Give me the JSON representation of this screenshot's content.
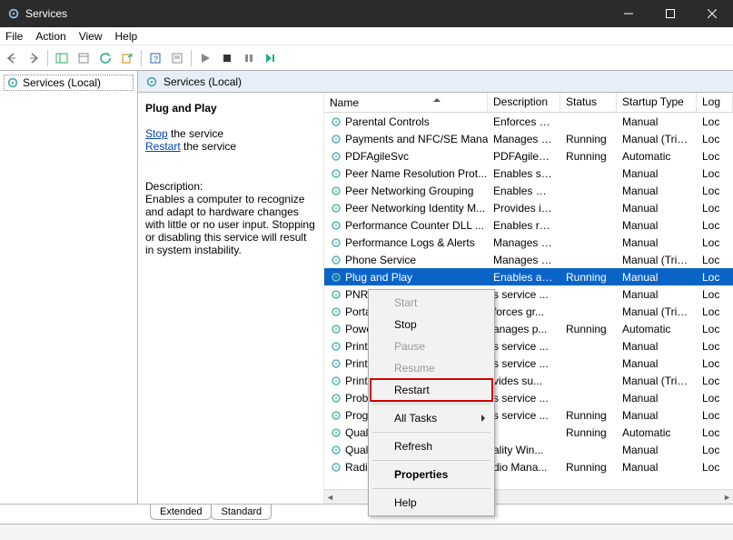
{
  "window": {
    "title": "Services"
  },
  "menubar": [
    "File",
    "Action",
    "View",
    "Help"
  ],
  "tree": {
    "root_label": "Services (Local)"
  },
  "main_header": "Services (Local)",
  "detail": {
    "selected_name": "Plug and Play",
    "stop_link": "Stop",
    "stop_suffix": " the service",
    "restart_link": "Restart",
    "restart_suffix": " the service",
    "desc_label": "Description:",
    "description": "Enables a computer to recognize and adapt to hardware changes with little or no user input. Stopping or disabling this service will result in system instability."
  },
  "columns": {
    "name": "Name",
    "desc": "Description",
    "status": "Status",
    "startup": "Startup Type",
    "logon": "Log"
  },
  "services": [
    {
      "name": "Parental Controls",
      "desc": "Enforces pa...",
      "status": "",
      "startup": "Manual",
      "logon": "Loc"
    },
    {
      "name": "Payments and NFC/SE Mana...",
      "desc": "Manages pa...",
      "status": "Running",
      "startup": "Manual (Trig...",
      "logon": "Loc"
    },
    {
      "name": "PDFAgileSvc",
      "desc": "PDFAgileSvc",
      "status": "Running",
      "startup": "Automatic",
      "logon": "Loc"
    },
    {
      "name": "Peer Name Resolution Prot...",
      "desc": "Enables serv...",
      "status": "",
      "startup": "Manual",
      "logon": "Loc"
    },
    {
      "name": "Peer Networking Grouping",
      "desc": "Enables mul...",
      "status": "",
      "startup": "Manual",
      "logon": "Loc"
    },
    {
      "name": "Peer Networking Identity M...",
      "desc": "Provides ide...",
      "status": "",
      "startup": "Manual",
      "logon": "Loc"
    },
    {
      "name": "Performance Counter DLL ...",
      "desc": "Enables rem...",
      "status": "",
      "startup": "Manual",
      "logon": "Loc"
    },
    {
      "name": "Performance Logs & Alerts",
      "desc": "Manages th...",
      "status": "",
      "startup": "Manual",
      "logon": "Loc"
    },
    {
      "name": "Phone Service",
      "desc": "Manages th...",
      "status": "",
      "startup": "Manual (Trig...",
      "logon": "Loc"
    },
    {
      "name": "Plug and Play",
      "desc": "Enables a c...",
      "status": "Running",
      "startup": "Manual",
      "logon": "Loc",
      "selected": true
    },
    {
      "name": "PNRP",
      "desc": "s service ...",
      "status": "",
      "startup": "Manual",
      "logon": "Loc"
    },
    {
      "name": "Portab",
      "desc": "forces gr...",
      "status": "",
      "startup": "Manual (Trig...",
      "logon": "Loc"
    },
    {
      "name": "Power",
      "desc": "anages p...",
      "status": "Running",
      "startup": "Automatic",
      "logon": "Loc"
    },
    {
      "name": "Print S",
      "desc": "s service ...",
      "status": "",
      "startup": "Manual",
      "logon": "Loc"
    },
    {
      "name": "Printer",
      "desc": "s service ...",
      "status": "",
      "startup": "Manual",
      "logon": "Loc"
    },
    {
      "name": "PrintW",
      "desc": "vides su...",
      "status": "",
      "startup": "Manual (Trig...",
      "logon": "Loc"
    },
    {
      "name": "Proble",
      "desc": "s service ...",
      "status": "",
      "startup": "Manual",
      "logon": "Loc"
    },
    {
      "name": "Progra",
      "desc": "s service ...",
      "status": "Running",
      "startup": "Manual",
      "logon": "Loc"
    },
    {
      "name": "Qualco",
      "desc": "",
      "status": "Running",
      "startup": "Automatic",
      "logon": "Loc"
    },
    {
      "name": "Qualit",
      "desc": "ality Win...",
      "status": "",
      "startup": "Manual",
      "logon": "Loc"
    },
    {
      "name": "Radio ",
      "desc": "dio Mana...",
      "status": "Running",
      "startup": "Manual",
      "logon": "Loc"
    }
  ],
  "context_menu": [
    {
      "label": "Start",
      "disabled": true
    },
    {
      "label": "Stop"
    },
    {
      "label": "Pause",
      "disabled": true
    },
    {
      "label": "Resume",
      "disabled": true
    },
    {
      "label": "Restart",
      "highlighted": true
    },
    {
      "sep": true
    },
    {
      "label": "All Tasks",
      "submenu": true
    },
    {
      "sep": true
    },
    {
      "label": "Refresh"
    },
    {
      "sep": true
    },
    {
      "label": "Properties",
      "bold": true
    },
    {
      "sep": true
    },
    {
      "label": "Help"
    }
  ],
  "tabs": {
    "extended": "Extended",
    "standard": "Standard"
  }
}
